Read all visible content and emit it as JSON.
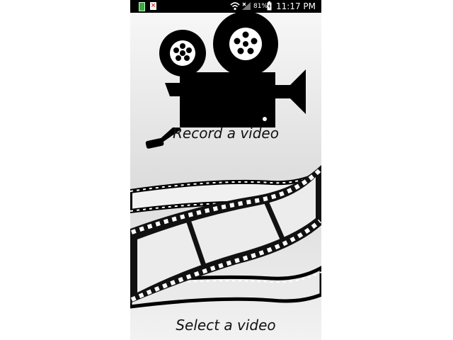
{
  "status_bar": {
    "battery_percent": "81%",
    "time": "11:17 PM",
    "icons": [
      "notification-green-icon",
      "notification-error-icon",
      "wifi-icon",
      "no-signal-icon",
      "battery-charging-icon"
    ]
  },
  "record": {
    "label": "Record a video",
    "icon": "movie-camera-icon"
  },
  "select": {
    "label": "Select a video",
    "icon": "film-strip-icon"
  },
  "colors": {
    "status_bar": "#000000",
    "icon": "#000000",
    "background": "#f2f2f2"
  }
}
